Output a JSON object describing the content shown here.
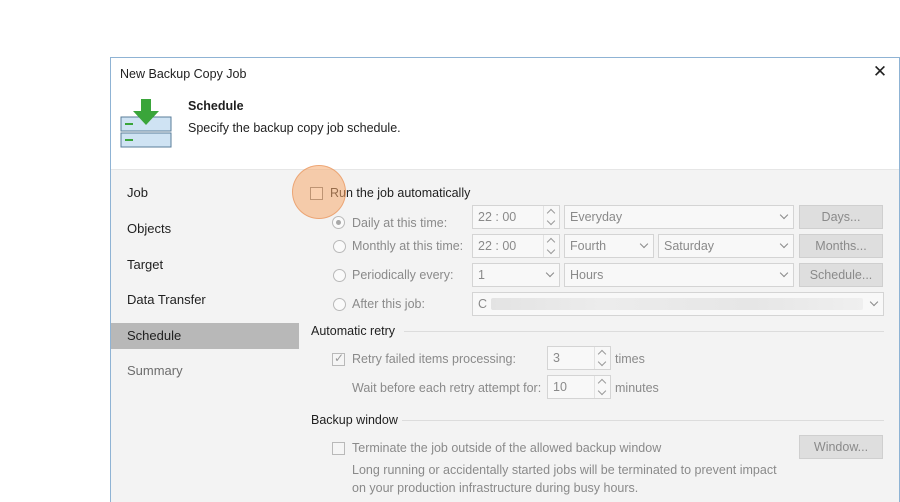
{
  "window": {
    "title": "New Backup Copy Job",
    "close_glyph": "✕"
  },
  "header": {
    "title": "Schedule",
    "subtitle": "Specify the backup copy job schedule.",
    "icon": "backup-copy-icon"
  },
  "sidebar": {
    "items": [
      {
        "label": "Job",
        "state": "normal"
      },
      {
        "label": "Objects",
        "state": "normal"
      },
      {
        "label": "Target",
        "state": "normal"
      },
      {
        "label": "Data Transfer",
        "state": "normal"
      },
      {
        "label": "Schedule",
        "state": "active"
      },
      {
        "label": "Summary",
        "state": "disabled"
      }
    ]
  },
  "schedule": {
    "run_automatically": {
      "label": "Run the job automatically",
      "checked": false
    },
    "daily": {
      "label": "Daily at this time:",
      "time": "22 : 00",
      "days": "Everyday",
      "button": "Days...",
      "selected": true
    },
    "monthly": {
      "label": "Monthly at this time:",
      "time": "22 : 00",
      "week": "Fourth",
      "day": "Saturday",
      "button": "Months...",
      "selected": false
    },
    "periodically": {
      "label": "Periodically every:",
      "value": "1",
      "unit": "Hours",
      "button": "Schedule...",
      "selected": false
    },
    "after_job": {
      "label": "After this job:",
      "value": "C",
      "selected": false
    }
  },
  "retry": {
    "group_label": "Automatic retry",
    "retry_failed": {
      "label": "Retry failed items processing:",
      "value": "3",
      "unit": "times",
      "checked": true
    },
    "wait": {
      "label": "Wait before each retry attempt for:",
      "value": "10",
      "unit": "minutes"
    }
  },
  "backup_window": {
    "group_label": "Backup window",
    "terminate": {
      "label": "Terminate the job outside of the allowed backup window",
      "checked": false
    },
    "button": "Window...",
    "note_line1": "Long running or accidentally started jobs will be terminated to prevent impact",
    "note_line2": "on your production infrastructure during busy hours."
  },
  "colors": {
    "accent_highlight": "#f5aa6e",
    "dialog_border": "#8fb3d4",
    "active_nav": "#b8b8b8",
    "icon_green": "#3aa53a",
    "icon_blue": "#cfe3f3"
  }
}
